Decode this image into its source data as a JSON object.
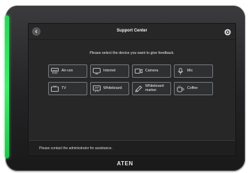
{
  "header": {
    "title": "Support Center",
    "back_icon": "chevron-left-icon",
    "settings_icon": "gear-icon"
  },
  "prompt": "Please select the device you want to give feedback.",
  "devices": [
    {
      "label": "Air-con",
      "icon": "air-conditioner-icon"
    },
    {
      "label": "Internet",
      "icon": "monitor-icon"
    },
    {
      "label": "Camera",
      "icon": "camera-icon"
    },
    {
      "label": "Mic",
      "icon": "microphone-icon"
    },
    {
      "label": "TV",
      "icon": "tv-icon"
    },
    {
      "label": "Whiteboard",
      "icon": "whiteboard-icon"
    },
    {
      "label": "Whiteboard marker",
      "icon": "marker-icon"
    },
    {
      "label": "Coffee",
      "icon": "coffee-cup-icon"
    }
  ],
  "footer": {
    "contact_text": "Please contact the administrator for assistance."
  },
  "brand": "ATEN",
  "colors": {
    "status_led": "#3fee6b",
    "screen_bg": "#272728",
    "tile_border": "#777a7e"
  }
}
